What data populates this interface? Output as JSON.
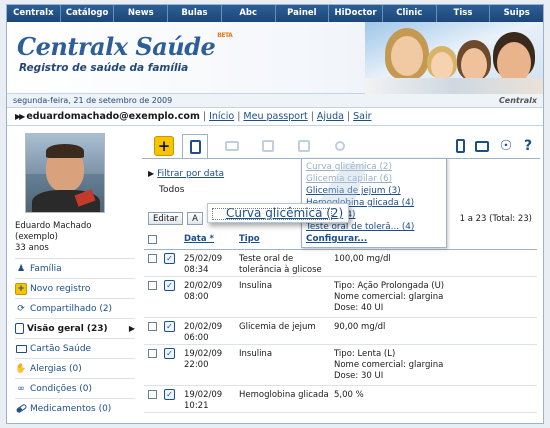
{
  "topnav": [
    "Centralx",
    "Catálogo",
    "News",
    "Bulas",
    "Abc",
    "Painel",
    "HiDoctor",
    "Clinic",
    "Tiss",
    "Suips"
  ],
  "banner": {
    "brand": "Centralx Saúde",
    "beta": "BETA",
    "tagline": "Registro de saúde da família"
  },
  "datebar": {
    "date": "segunda-feira, 21 de setembro de 2009",
    "brand": "Centralx"
  },
  "userbar": {
    "email": "eduardomachado@exemplo.com",
    "links": [
      "Início",
      "Meu passport",
      "Ajuda",
      "Sair"
    ]
  },
  "profile": {
    "name_line1": "Eduardo Machado",
    "name_line2": "(exemplo)",
    "age": "33 anos"
  },
  "sidebar": [
    {
      "label": "Família",
      "icon": "family-icon"
    },
    {
      "label": "Novo registro",
      "icon": "plus-icon"
    },
    {
      "label": "Compartilhado (2)",
      "icon": "share-icon"
    },
    {
      "label": "Visão geral (23)",
      "icon": "overview-icon",
      "active": true
    },
    {
      "label": "Cartão Saúde",
      "icon": "card-icon"
    },
    {
      "label": "Alergias (0)",
      "icon": "allergy-icon"
    },
    {
      "label": "Condições (0)",
      "icon": "stethoscope-icon"
    },
    {
      "label": "Medicamentos (0)",
      "icon": "pill-icon"
    }
  ],
  "filter": {
    "link": "Filtrar por data",
    "value": "Todos"
  },
  "buttons": {
    "edit": "Editar",
    "second": "A"
  },
  "paging": "1 a 23 (Total: 23)",
  "table": {
    "headers": {
      "data": "Data *",
      "tipo": "Tipo"
    },
    "rows": [
      {
        "date": "25/02/09",
        "time": "08:34",
        "tipo": "Teste oral de tolerância à glicose",
        "valor": [
          "100,00 mg/dl"
        ]
      },
      {
        "date": "20/02/09",
        "time": "08:00",
        "tipo": "Insulina",
        "valor": [
          "Tipo: Ação Prolongada (U)",
          "Nome comercial: glargina",
          "Dose: 40 UI"
        ]
      },
      {
        "date": "20/02/09",
        "time": "06:00",
        "tipo": "Glicemia de jejum",
        "valor": [
          "90,00 mg/dl"
        ]
      },
      {
        "date": "19/02/09",
        "time": "22:00",
        "tipo": "Insulina",
        "valor": [
          "Tipo: Lenta (L)",
          "Nome comercial: glargina",
          "Dose: 30 UI"
        ]
      },
      {
        "date": "19/02/09",
        "time": "10:21",
        "tipo": "Hemoglobina glicada",
        "valor": [
          "5,00 %"
        ]
      }
    ]
  },
  "dropdown": {
    "items": [
      "Curva glicêmica (2)",
      "Glicemia capilar (6)",
      "Glicemia de jejum (3)",
      "Hemoglobina glicada (4)",
      "Insulina (4)",
      "Teste oral de tolerâ... (4)"
    ],
    "config": "Configurar..."
  },
  "zoom": {
    "label": "Curva glicêmica (2)"
  }
}
